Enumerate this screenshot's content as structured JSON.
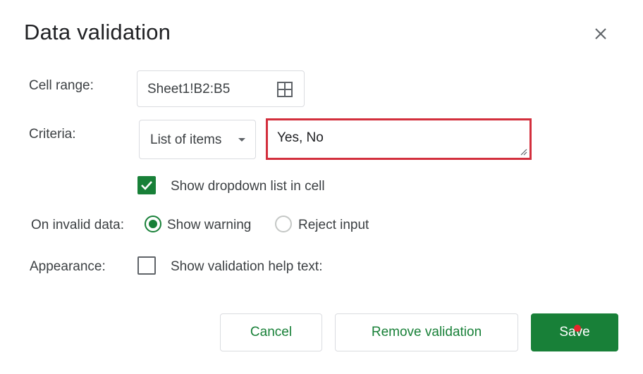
{
  "dialog": {
    "title": "Data validation"
  },
  "cell_range": {
    "label": "Cell range:",
    "value": "Sheet1!B2:B5",
    "icon": "select-range-icon"
  },
  "criteria": {
    "label": "Criteria:",
    "type_selected": "List of items",
    "items_value": "Yes, No",
    "highlight_color": "#d32f3d"
  },
  "dropdown_option": {
    "label": "Show dropdown list in cell",
    "checked": true
  },
  "invalid_data": {
    "label": "On invalid data:",
    "options": [
      "Show warning",
      "Reject input"
    ],
    "selected": "Show warning"
  },
  "appearance": {
    "label": "Appearance:",
    "help_text_label": "Show validation help text:",
    "checked": false
  },
  "buttons": {
    "cancel": "Cancel",
    "remove": "Remove validation",
    "save": "Save"
  },
  "colors": {
    "accent": "#188038",
    "cursor": "#e8262d"
  }
}
